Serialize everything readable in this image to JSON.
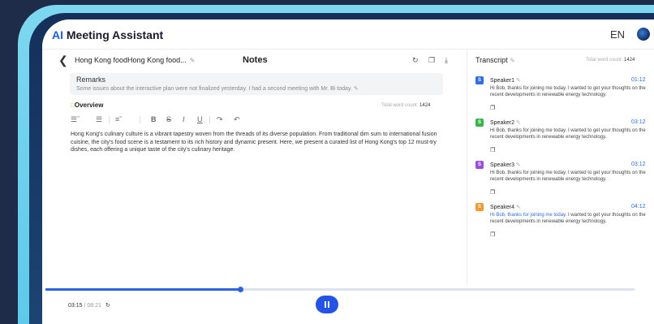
{
  "header": {
    "brand_ai": "AI",
    "brand_rest": " Meeting Assistant",
    "lang": "EN"
  },
  "notes": {
    "doc_title": "Hong Kong foodHong Kong food...",
    "panel_title": "Notes",
    "remarks": {
      "label": "Remarks",
      "text": "Some issues about the interactive plan were not finalized yesterday. I had a second meeting with Mr. Bi today."
    },
    "overview_label": "Overview",
    "word_count_label": "Total word count:",
    "word_count": "1424",
    "body": "Hong Kong's culinary culture is a vibrant tapestry woven from the threads of its diverse population. From traditional dim sum to international fusion cuisine, the city's food scene is a testament to its rich history and dynamic present. Here, we present a curated list of Hong Kong's top 12 must-try dishes, each offering a unique taste of the city's culinary heritage."
  },
  "transcript": {
    "title": "Transcript",
    "word_count_label": "Total word count:",
    "word_count": "1424",
    "speakers": [
      {
        "initial": "S",
        "name": "Speaker1",
        "time": "01:12",
        "color": "#2f6bea",
        "text": "Hi Bob, thanks for joining me today. I wanted to get your thoughts on the recent developments in renewable energy technology."
      },
      {
        "initial": "S",
        "name": "Speaker2",
        "time": "03:12",
        "color": "#3ab34a",
        "text": "Hi Bob, thanks for joining me today. I wanted to get your thoughts on the recent developments in renewable energy technology."
      },
      {
        "initial": "S",
        "name": "Speaker3",
        "time": "03:12",
        "color": "#9b4de0",
        "text": "Hi Bob, thanks for joining me today. I wanted to get your thoughts on the recent developments in renewable energy technology."
      },
      {
        "initial": "S",
        "name": "Speaker4",
        "time": "04:12",
        "color": "#f29a2e",
        "text_highlight": "Hi Bob, thanks for joining me today.",
        "text_rest": " I wanted to get your thoughts on the recent developments in renewable energy technology."
      }
    ]
  },
  "player": {
    "current": "03:15",
    "separator": " / ",
    "total": "08:21",
    "progress_percent": 33
  },
  "colors": {
    "accent": "#2354e6",
    "highlight_text": "#2a6ee0"
  }
}
